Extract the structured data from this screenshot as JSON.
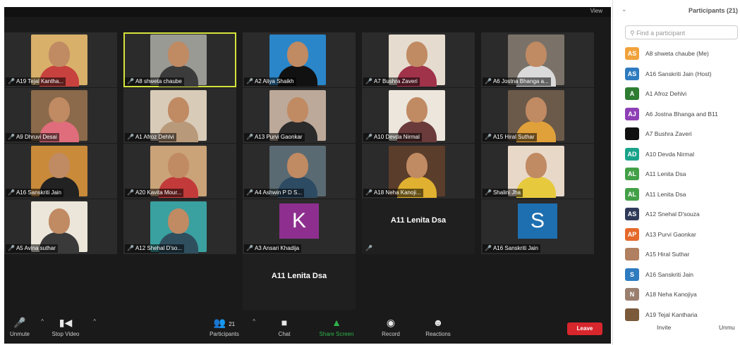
{
  "top": {
    "view_label": "View"
  },
  "tiles": [
    {
      "id": "a19",
      "label": "A19 Tejal Kantha...",
      "bg": "#d8b06a",
      "shirt": "#c7413e"
    },
    {
      "id": "a8",
      "label": "A8 shweta chaube",
      "bg": "#9a9a94",
      "shirt": "#3b3b3b",
      "active": true
    },
    {
      "id": "a2",
      "label": "A2 Aliya Shaikh",
      "bg": "#2a86c8",
      "shirt": "#111111"
    },
    {
      "id": "a7",
      "label": "A7 Bushra Zaveri",
      "bg": "#e5dccf",
      "shirt": "#a0324a"
    },
    {
      "id": "a6",
      "label": "A6 Jostna Bhanga a...",
      "bg": "#7a7268",
      "shirt": "#dadada"
    },
    {
      "id": "a9",
      "label": "A9 Dhruvi Desai",
      "bg": "#8a6a4a",
      "shirt": "#e06d7b"
    },
    {
      "id": "a1",
      "label": "A1 Afroz Dehlvi",
      "bg": "#d8cbb8",
      "shirt": "#b89a7a"
    },
    {
      "id": "a13",
      "label": "A13 Purvi Gaonkar",
      "bg": "#bca99a",
      "shirt": "#2b2b2b"
    },
    {
      "id": "a10",
      "label": "A10 Devda Nirmal",
      "bg": "#ece6dc",
      "shirt": "#6b3a3a"
    },
    {
      "id": "a15",
      "label": "A15 Hiral Suthar",
      "bg": "#6b5a4a",
      "shirt": "#e0a03a"
    },
    {
      "id": "a16b",
      "label": "A16 Sanskriti Jain",
      "bg": "#c98a3a",
      "shirt": "#222222"
    },
    {
      "id": "a20",
      "label": "A20 Kavita Mour...",
      "bg": "#caa378",
      "shirt": "#c23a3a"
    },
    {
      "id": "a4",
      "label": "A4 Ashwin P D S...",
      "bg": "#5a6a72",
      "shirt": "#2d4b63"
    },
    {
      "id": "a18",
      "label": "A18 Neha Kanoji...",
      "bg": "#5a3d2b",
      "shirt": "#e0b030"
    },
    {
      "id": "shalini",
      "label": "Shalini Jha",
      "bg": "#e8d8c8",
      "shirt": "#e7c93e"
    },
    {
      "id": "a5",
      "label": "A5 Avina suthar",
      "bg": "#ece6da",
      "shirt": "#3a3a3a"
    },
    {
      "id": "a12",
      "label": "A12 Shehal D'so...",
      "bg": "#3aa0a0",
      "shirt": "#2f4f5f"
    },
    {
      "id": "a3",
      "label": "A3 Ansari Khadija",
      "avatar": "K",
      "avatar_bg": "#8e2f8f"
    },
    {
      "id": "a11a",
      "name_only": "A11 Lenita Dsa"
    },
    {
      "id": "a16c",
      "label": "A16 Sanskriti Jain",
      "avatar": "S",
      "avatar_bg": "#1e6fb0"
    },
    {
      "id": "a11b",
      "name_only": "A11 Lenita Dsa"
    }
  ],
  "toolbar": {
    "unmute_label": "Unmute",
    "stop_video_label": "Stop Video",
    "participants_label": "Participants",
    "participants_count": "21",
    "chat_label": "Chat",
    "share_label": "Share Screen",
    "record_label": "Record",
    "reactions_label": "Reactions",
    "leave_label": "Leave"
  },
  "panel": {
    "title": "Participants (21)",
    "search_placeholder": "Find a participant",
    "participants": [
      {
        "initials": "AS",
        "color": "#f0a23a",
        "name": "A8 shweta chaube (Me)"
      },
      {
        "initials": "AS",
        "color": "#2e7bbf",
        "name": "A16 Sanskriti Jain (Host)"
      },
      {
        "initials": "A",
        "color": "#2e7d32",
        "name": "A1 Afroz Dehlvi"
      },
      {
        "initials": "AJ",
        "color": "#8e3fb5",
        "name": "A6 Jostna Bhanga and B11"
      },
      {
        "initials": "",
        "color": "#111111",
        "name": "A7 Bushra Zaveri"
      },
      {
        "initials": "AD",
        "color": "#19a38a",
        "name": "A10 Devda Nirmal"
      },
      {
        "initials": "AL",
        "color": "#43a047",
        "name": "A11 Lenita Dsa"
      },
      {
        "initials": "AL",
        "color": "#43a047",
        "name": "A11 Lenita Dsa"
      },
      {
        "initials": "AS",
        "color": "#2f3a5a",
        "name": "A12 Snehal D'souza"
      },
      {
        "initials": "AP",
        "color": "#e5692a",
        "name": "A13 Purvi Gaonkar"
      },
      {
        "initials": "",
        "color": "#b08060",
        "name": "A15 Hiral Suthar"
      },
      {
        "initials": "S",
        "color": "#2e7bbf",
        "name": "A16 Sanskriti Jain"
      },
      {
        "initials": "N",
        "color": "#9a7f6f",
        "name": "A18 Neha Kanojiya"
      },
      {
        "initials": "",
        "color": "#7a5a3a",
        "name": "A19 Tejal Kantharia"
      }
    ],
    "invite_label": "Invite",
    "mute_all_label": "Unmu"
  }
}
